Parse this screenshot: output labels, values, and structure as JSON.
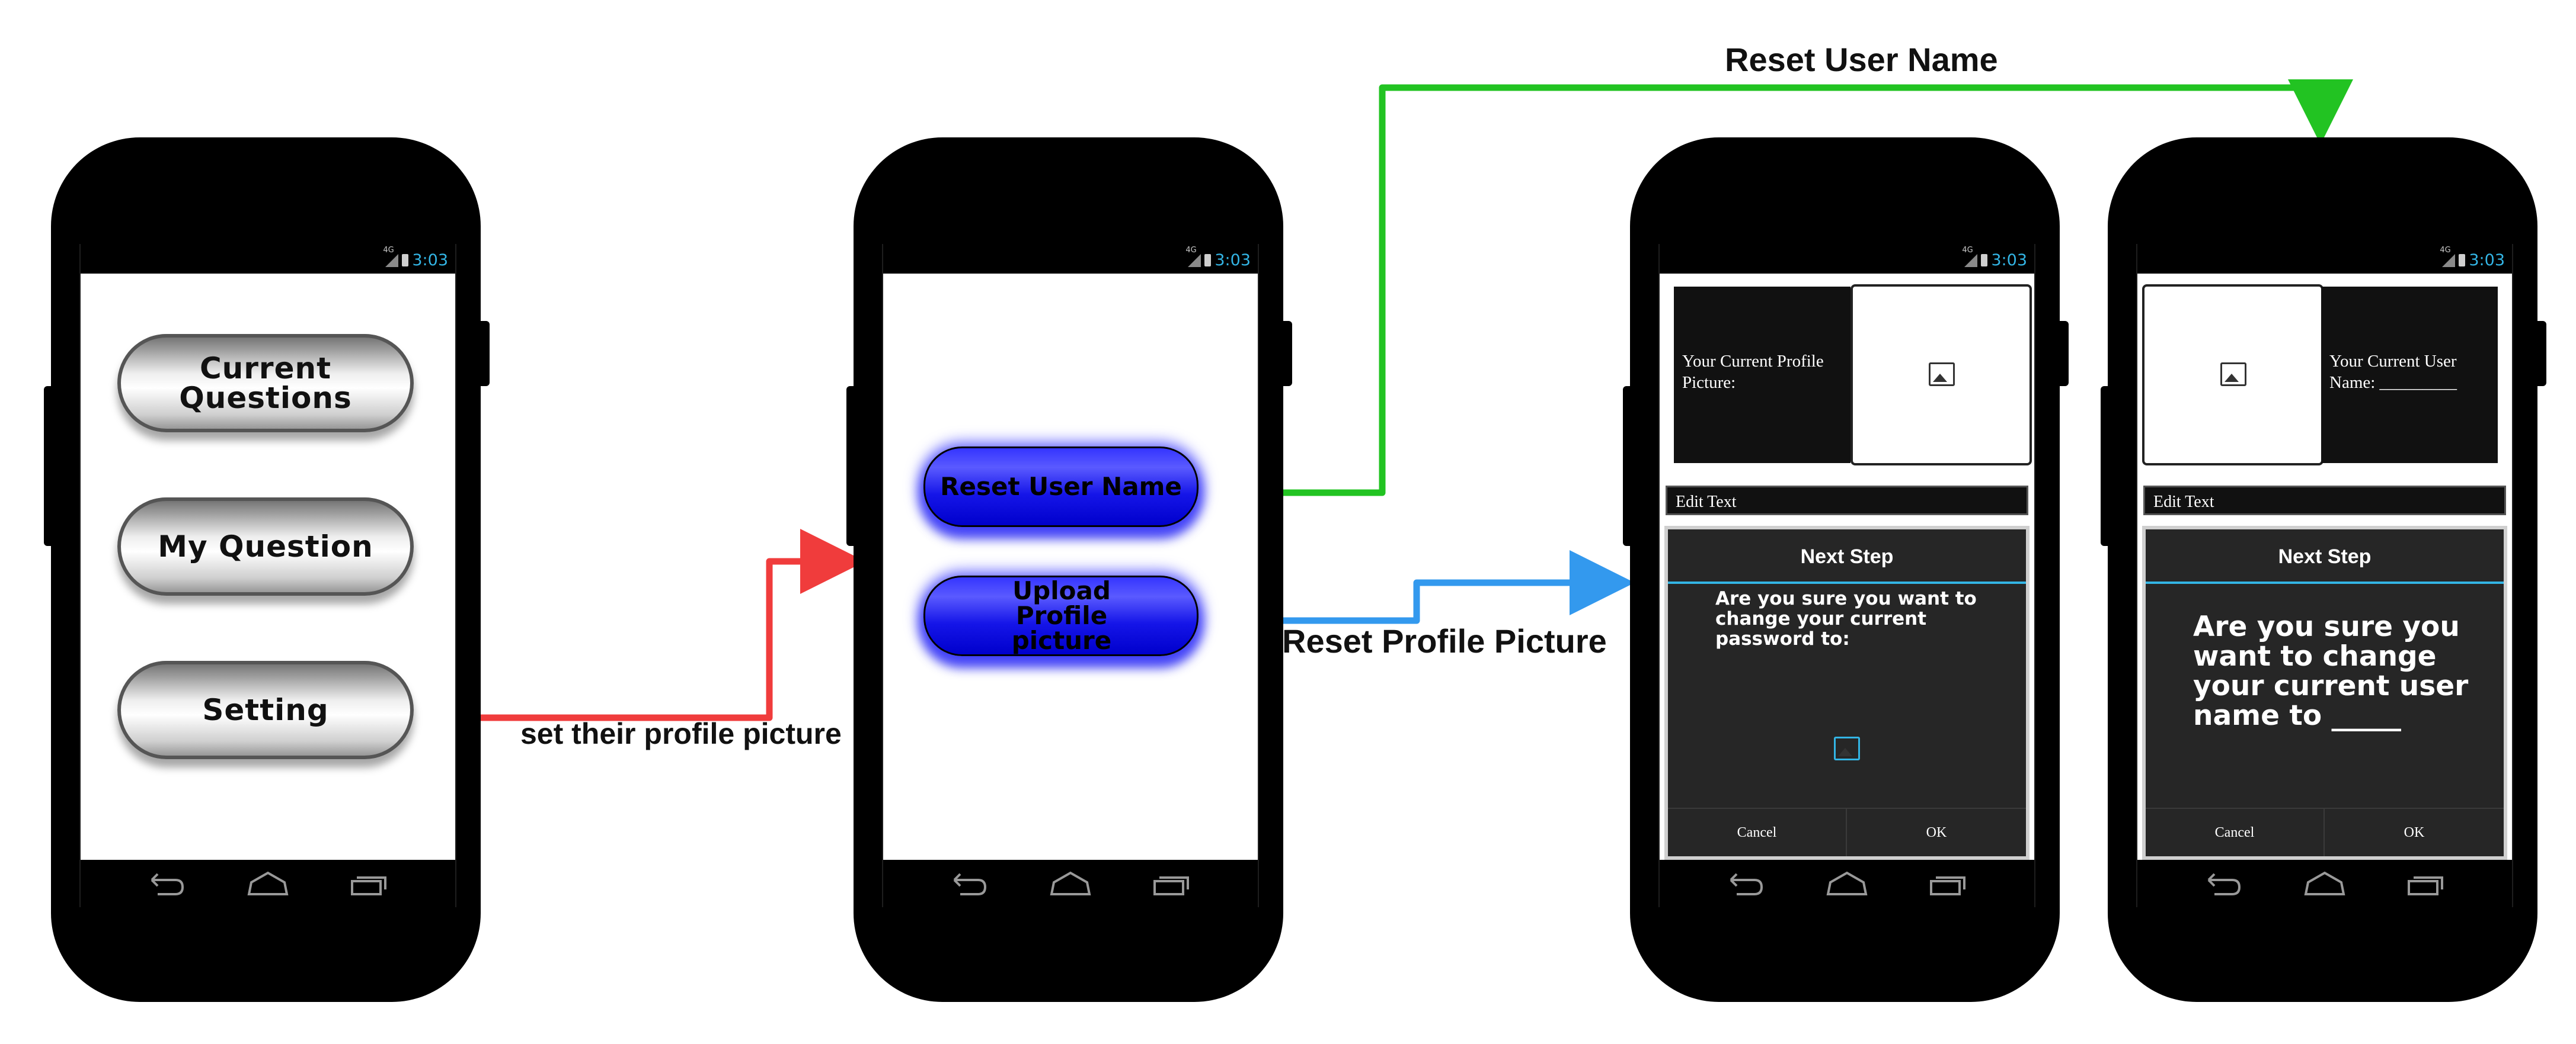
{
  "status_time": "3:03",
  "status_network": "4G",
  "screens": {
    "main_menu": {
      "buttons": [
        "Current Questions",
        "My Question",
        "Setting"
      ]
    },
    "settings": {
      "buttons": [
        "Reset User Name",
        "Upload Profile picture"
      ]
    },
    "reset_picture": {
      "info_label": "Your Current Profile Picture:",
      "edit_text": "Edit Text",
      "dialog_title": "Next Step",
      "dialog_message": "Are you sure you want to change your current password to:",
      "cancel": "Cancel",
      "ok": "OK"
    },
    "reset_name": {
      "info_label": "Your Current User Name: _________",
      "edit_text": "Edit Text",
      "dialog_title": "Next Step",
      "dialog_message": "Are you sure you want to change your current user name to _____",
      "cancel": "Cancel",
      "ok": "OK"
    }
  },
  "flows": {
    "set_profile": "set their profile picture",
    "reset_user_name": "Reset User Name",
    "reset_profile_picture": "Reset Profile Picture"
  },
  "colors": {
    "set_profile_arrow": "#f03c3c",
    "reset_user_name_arrow": "#22c322",
    "reset_profile_picture_arrow": "#3399ee",
    "status_accent": "#33b5e5"
  }
}
